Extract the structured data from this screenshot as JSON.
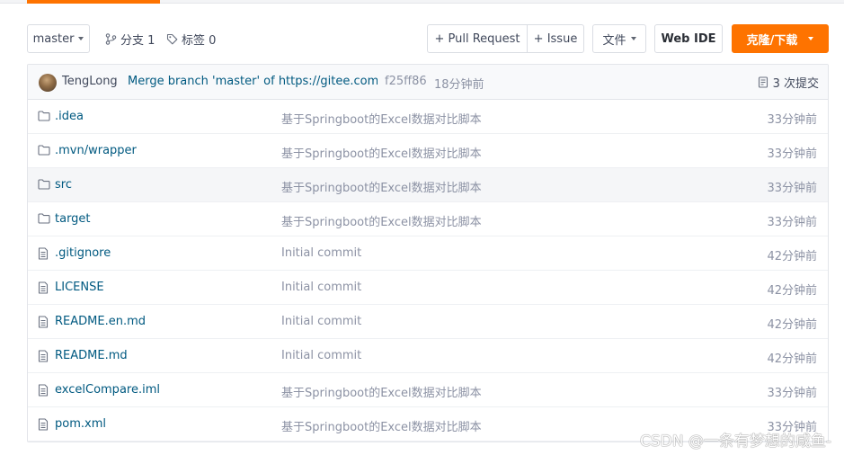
{
  "toolbar": {
    "branch_select": "master",
    "branches_label": "分支 1",
    "tags_label": "标签 0",
    "pull_request_label": "+ Pull Request",
    "issue_label": "+ Issue",
    "file_menu_label": "文件",
    "web_ide_label": "Web IDE",
    "clone_label": "克隆/下载"
  },
  "commit": {
    "author": "TengLong",
    "message": "Merge branch 'master' of https://gitee.com...",
    "hash": "f25ff86",
    "time": "18分钟前",
    "count_label": "3 次提交"
  },
  "files": [
    {
      "name": ".idea",
      "type": "folder",
      "message": "基于Springboot的Excel数据对比脚本",
      "time": "33分钟前"
    },
    {
      "name": ".mvn/wrapper",
      "type": "folder",
      "message": "基于Springboot的Excel数据对比脚本",
      "time": "33分钟前"
    },
    {
      "name": "src",
      "type": "folder",
      "message": "基于Springboot的Excel数据对比脚本",
      "time": "33分钟前"
    },
    {
      "name": "target",
      "type": "folder",
      "message": "基于Springboot的Excel数据对比脚本",
      "time": "33分钟前"
    },
    {
      "name": ".gitignore",
      "type": "file",
      "message": "Initial commit",
      "time": "42分钟前"
    },
    {
      "name": "LICENSE",
      "type": "file",
      "message": "Initial commit",
      "time": "42分钟前"
    },
    {
      "name": "README.en.md",
      "type": "file",
      "message": "Initial commit",
      "time": "42分钟前"
    },
    {
      "name": "README.md",
      "type": "file",
      "message": "Initial commit",
      "time": "42分钟前"
    },
    {
      "name": "excelCompare.iml",
      "type": "file",
      "message": "基于Springboot的Excel数据对比脚本",
      "time": "33分钟前"
    },
    {
      "name": "pom.xml",
      "type": "file",
      "message": "基于Springboot的Excel数据对比脚本",
      "time": "33分钟前"
    }
  ],
  "watermark": "CSDN @一条有梦想的咸鱼-",
  "colors": {
    "accent": "#fe7300",
    "link": "#005980",
    "muted": "#8c92a4"
  }
}
